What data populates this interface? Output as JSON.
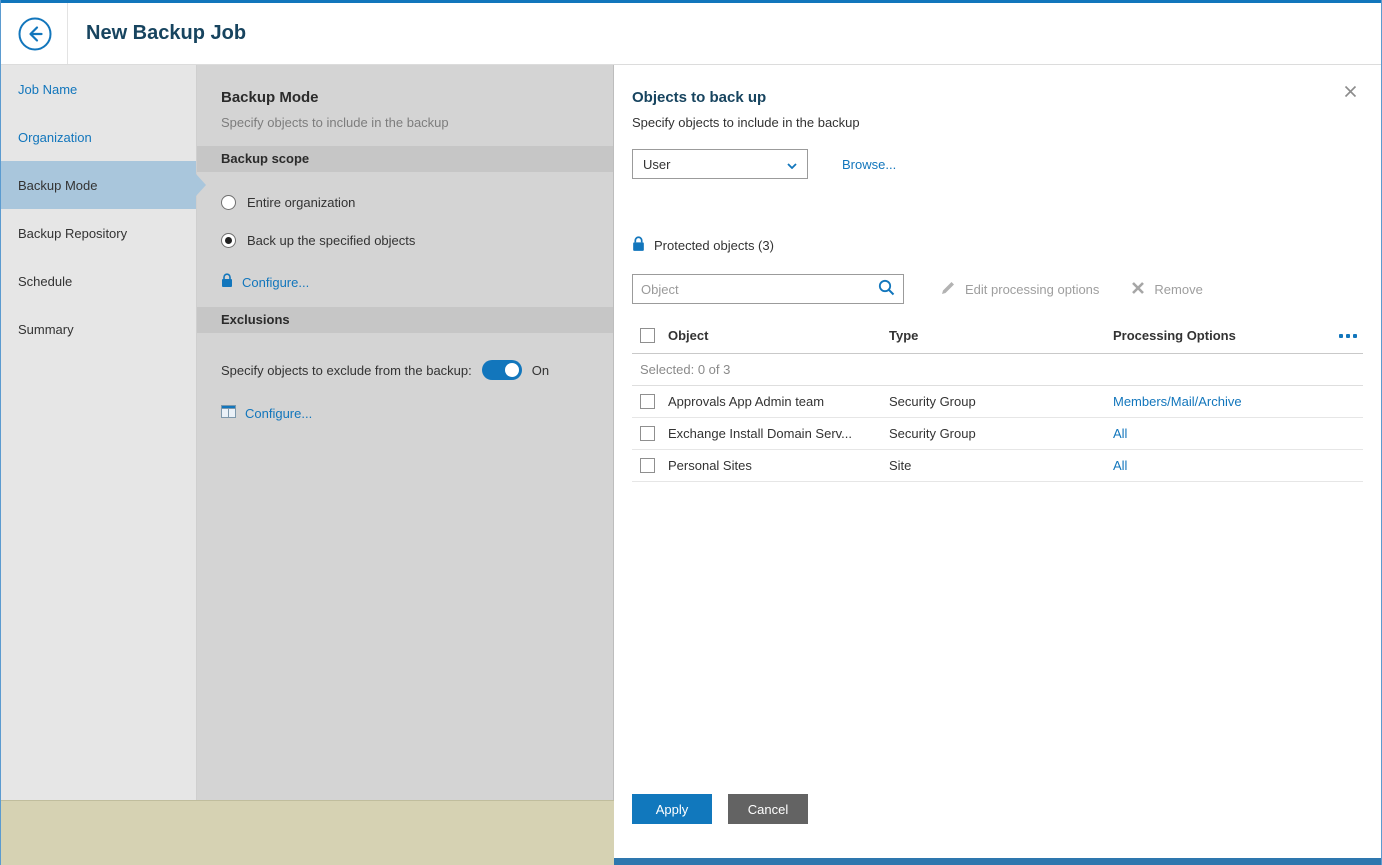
{
  "window": {
    "title": "New Backup Job"
  },
  "colors": {
    "accent": "#1276bc",
    "active_step_bg": "#a9c6dc",
    "apply_button": "#1178bd",
    "cancel_button": "#636363",
    "footer_strip": "#d6d2b3"
  },
  "icons": {
    "back": "arrow-left-in-circle",
    "close": "x",
    "search": "magnifier",
    "edit": "pencil",
    "remove": "x",
    "protected": "lock",
    "scope_configure": "lock",
    "exclusions_configure": "table-window",
    "select_chevron": "chevron-down",
    "column_chooser": "three-dots"
  },
  "sidebar": {
    "items": [
      {
        "label": "Job Name"
      },
      {
        "label": "Organization"
      },
      {
        "label": "Backup Mode"
      },
      {
        "label": "Backup Repository"
      },
      {
        "label": "Schedule"
      },
      {
        "label": "Summary"
      }
    ]
  },
  "panel": {
    "title": "Backup Mode",
    "subtitle": "Specify objects to include in the backup",
    "scope": {
      "header": "Backup scope",
      "options": [
        {
          "label": "Entire organization",
          "selected": false
        },
        {
          "label": "Back up the specified objects",
          "selected": true
        }
      ],
      "configure_label": "Configure..."
    },
    "exclusions": {
      "header": "Exclusions",
      "toggle_label": "Specify objects to exclude from the backup:",
      "toggle_state": "On",
      "configure_label": "Configure..."
    }
  },
  "flyout": {
    "title": "Objects to back up",
    "subtitle": "Specify objects to include in the backup",
    "type_select": {
      "value": "User"
    },
    "browse_label": "Browse...",
    "protected_header": "Protected objects (3)",
    "search_placeholder": "Object",
    "toolbar": {
      "edit_label": "Edit processing options",
      "remove_label": "Remove"
    },
    "table": {
      "columns": [
        "Object",
        "Type",
        "Processing Options"
      ],
      "selected_summary": "Selected: 0 of 3",
      "rows": [
        {
          "object": "Approvals App Admin team",
          "type": "Security Group",
          "processing": "Members/Mail/Archive"
        },
        {
          "object": "Exchange Install Domain Serv...",
          "type": "Security Group",
          "processing": "All"
        },
        {
          "object": "Personal Sites",
          "type": "Site",
          "processing": "All"
        }
      ]
    },
    "apply_label": "Apply",
    "cancel_label": "Cancel"
  }
}
